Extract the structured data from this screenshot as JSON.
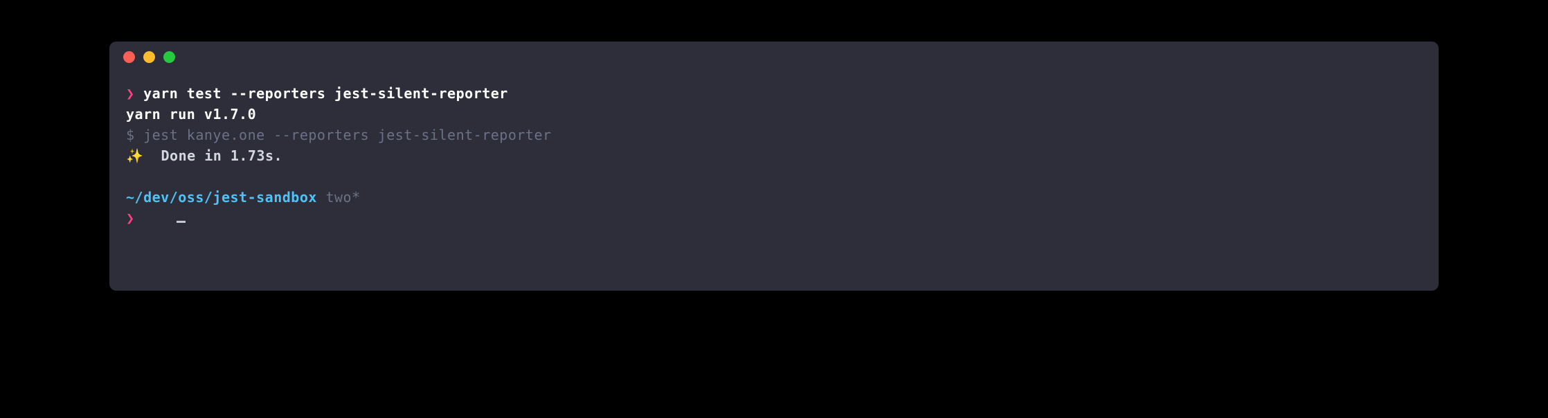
{
  "terminal": {
    "prompt_symbol": "❯",
    "lines": {
      "command": "yarn test --reporters jest-silent-reporter",
      "yarn_version": "yarn run v1.7.0",
      "jest_cmd_prefix": "$ ",
      "jest_cmd": "jest kanye.one --reporters jest-silent-reporter",
      "sparkle": "✨",
      "done_text": "  Done in 1.73s.",
      "cwd": "~/dev/oss/jest-sandbox",
      "branch": " two*"
    }
  },
  "colors": {
    "window_bg": "#2d2e3a",
    "page_bg": "#000000",
    "chevron": "#ff4081",
    "white": "#ffffff",
    "dim": "#6c7186",
    "cyan": "#4fc3f7",
    "sparkle": "#ffd966"
  }
}
